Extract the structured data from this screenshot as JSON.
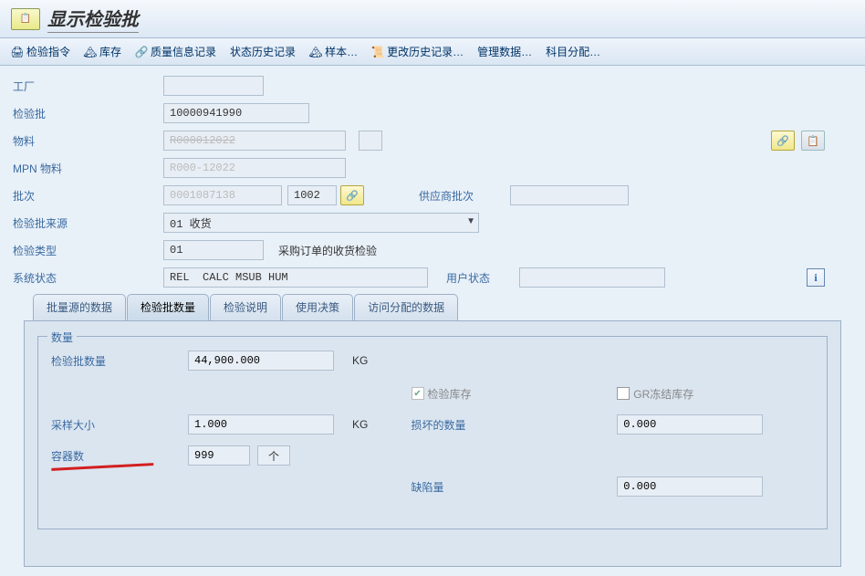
{
  "header": {
    "title": "显示检验批"
  },
  "toolbar": {
    "inspect_instruction": "检验指令",
    "stock": "库存",
    "quality_info": "质量信息记录",
    "status_history": "状态历史记录",
    "sample": "样本…",
    "change_history": "更改历史记录…",
    "admin_data": "管理数据…",
    "account_assign": "科目分配…"
  },
  "form": {
    "plant_label": "工厂",
    "plant_value": "",
    "lot_label": "检验批",
    "lot_value": "10000941990",
    "material_label": "物料",
    "material_value": "R000012022",
    "mpn_label": "MPN 物料",
    "mpn_value": "R000-12022",
    "batch_label": "批次",
    "batch_value": "0001087138",
    "batch_value2": "1002",
    "vendor_batch_label": "供应商批次",
    "vendor_batch_value": "",
    "origin_label": "检验批来源",
    "origin_value": "01 收货",
    "insp_type_label": "检验类型",
    "insp_type_value": "01",
    "insp_type_desc": "采购订单的收货检验",
    "sys_status_label": "系统状态",
    "sys_status_value": "REL  CALC MSUB HUM",
    "user_status_label": "用户状态",
    "user_status_value": ""
  },
  "tabs": {
    "t1": "批量源的数据",
    "t2": "检验批数量",
    "t3": "检验说明",
    "t4": "使用决策",
    "t5": "访问分配的数据"
  },
  "qty": {
    "group_title": "数量",
    "lot_qty_label": "检验批数量",
    "lot_qty_value": "44,900.000",
    "uom": "KG",
    "sample_size_label": "采样大小",
    "sample_size_value": "1.000",
    "containers_label": "容器数",
    "containers_value": "999",
    "containers_unit": "个",
    "insp_stock_label": "检验库存",
    "gr_blocked_label": "GR冻结库存",
    "damaged_label": "损坏的数量",
    "damaged_value": "0.000",
    "defects_label": "缺陷量",
    "defects_value": "0.000"
  }
}
